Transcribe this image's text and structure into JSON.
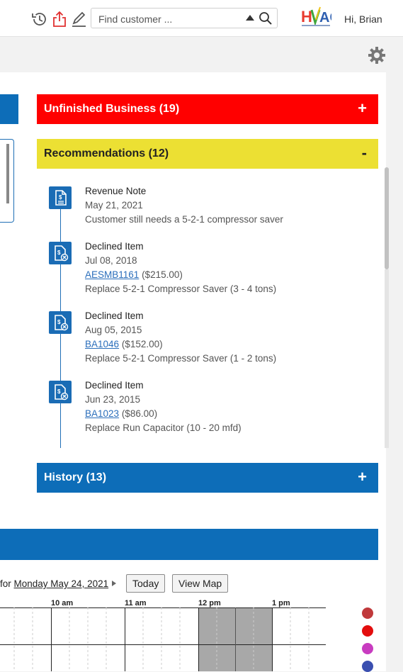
{
  "topbar": {
    "search_placeholder": "Find customer ...",
    "greeting": "Hi, Brian",
    "icons": [
      "history-icon",
      "export-icon",
      "edit-icon",
      "search-icon",
      "hvac-logo"
    ]
  },
  "sections": {
    "unfinished": {
      "title": "Unfinished Business (19)",
      "toggle": "+",
      "color": "#ff0000"
    },
    "recommendations": {
      "title": "Recommendations (12)",
      "toggle": "-",
      "color": "#ece033"
    },
    "history": {
      "title": "History (13)",
      "toggle": "+",
      "color": "#0d6db8"
    }
  },
  "timeline": [
    {
      "type": "Revenue Note",
      "date": "May 21, 2021",
      "code": "",
      "price": "",
      "desc": "Customer still needs a 5-2-1 compressor saver"
    },
    {
      "type": "Declined Item",
      "date": "Jul 08, 2018",
      "code": "AESMB1161",
      "price": "($215.00)",
      "desc": "Replace 5-2-1 Compressor Saver (3 - 4 tons)"
    },
    {
      "type": "Declined Item",
      "date": "Aug 05, 2015",
      "code": "BA1046",
      "price": "($152.00)",
      "desc": "Replace 5-2-1 Compressor Saver (1 - 2 tons)"
    },
    {
      "type": "Declined Item",
      "date": "Jun 23, 2015",
      "code": "BA1023",
      "price": "($86.00)",
      "desc": "Replace Run Capacitor (10 - 20 mfd)"
    }
  ],
  "schedule": {
    "label_prefix": "for ",
    "label_date": "Monday May 24, 2021",
    "today_button": "Today",
    "map_button": "View Map",
    "times": [
      "10 am",
      "11 am",
      "12 pm",
      "1 pm"
    ],
    "legend_colors": [
      "#c0393b",
      "#e30d0d",
      "#c83cc0",
      "#3a4fb0"
    ]
  }
}
